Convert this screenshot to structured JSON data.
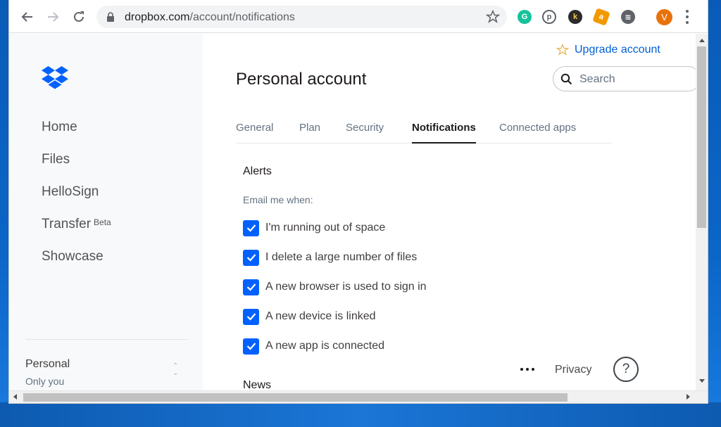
{
  "browser": {
    "url_domain": "dropbox.com",
    "url_path": "/account/notifications",
    "avatar_letter": "V",
    "colors": {
      "avatar": "#e8710a",
      "grammarly": "#15c39a",
      "pinterest": "#5f6368",
      "ext_orange": "#f29900"
    }
  },
  "sidebar": {
    "nav": [
      {
        "label": "Home"
      },
      {
        "label": "Files"
      },
      {
        "label": "HelloSign"
      },
      {
        "label": "Transfer",
        "badge": "Beta"
      },
      {
        "label": "Showcase"
      }
    ],
    "account": {
      "name": "Personal",
      "sub": "Only you"
    }
  },
  "header": {
    "upgrade_label": "Upgrade account",
    "search_placeholder": "Search",
    "title": "Personal account"
  },
  "tabs": [
    {
      "label": "General"
    },
    {
      "label": "Plan"
    },
    {
      "label": "Security"
    },
    {
      "label": "Notifications",
      "active": true
    },
    {
      "label": "Connected apps"
    }
  ],
  "alerts": {
    "section_title": "Alerts",
    "email_label": "Email me when:",
    "options": [
      {
        "label": "I'm running out of space",
        "checked": true
      },
      {
        "label": "I delete a large number of files",
        "checked": true
      },
      {
        "label": "A new browser is used to sign in",
        "checked": true
      },
      {
        "label": "A new device is linked",
        "checked": true
      },
      {
        "label": "A new app is connected",
        "checked": true
      }
    ]
  },
  "news_title": "News",
  "footer": {
    "privacy_label": "Privacy",
    "help_label": "?"
  },
  "theme": {
    "accent": "#0061fe",
    "text": "#1e1919",
    "muted": "#637282",
    "sidebar_bg": "#f7f9fa"
  }
}
